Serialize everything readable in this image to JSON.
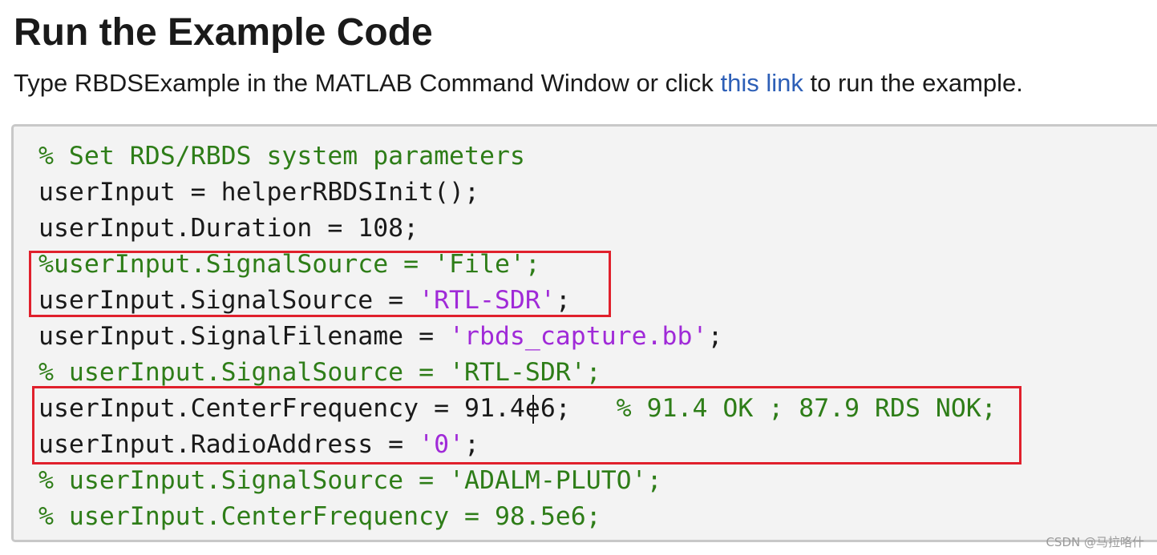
{
  "page": {
    "title": "Run the Example Code",
    "intro": {
      "before": "Type RBDSExample in the MATLAB Command Window or click ",
      "link_text": "this link",
      "after": " to run the example."
    }
  },
  "code_lines": [
    [
      {
        "text": "% Set RDS/RBDS system parameters",
        "type": "comment"
      }
    ],
    [
      {
        "text": "userInput = helperRBDSInit();",
        "type": "plain"
      }
    ],
    [
      {
        "text": "userInput.Duration = 108;",
        "type": "plain"
      }
    ],
    [
      {
        "text": "%userInput.SignalSource = 'File';",
        "type": "comment"
      }
    ],
    [
      {
        "text": "userInput.SignalSource = ",
        "type": "plain"
      },
      {
        "text": "'RTL-SDR'",
        "type": "string"
      },
      {
        "text": ";",
        "type": "plain"
      }
    ],
    [
      {
        "text": "userInput.SignalFilename = ",
        "type": "plain"
      },
      {
        "text": "'rbds_capture.bb'",
        "type": "string"
      },
      {
        "text": ";",
        "type": "plain"
      }
    ],
    [
      {
        "text": "% userInput.SignalSource = 'RTL-SDR';",
        "type": "comment"
      }
    ],
    [
      {
        "text": "userInput.CenterFrequency = 91.4e6;   ",
        "type": "plain"
      },
      {
        "text": "% 91.4 OK ; 87.9 RDS NOK;",
        "type": "comment"
      }
    ],
    [
      {
        "text": "userInput.RadioAddress = ",
        "type": "plain"
      },
      {
        "text": "'0'",
        "type": "string"
      },
      {
        "text": ";",
        "type": "plain"
      }
    ],
    [
      {
        "text": "% userInput.SignalSource = 'ADALM-PLUTO';",
        "type": "comment"
      }
    ],
    [
      {
        "text": "% userInput.CenterFrequency = 98.5e6;",
        "type": "comment"
      }
    ]
  ],
  "colors": {
    "comment": "#2e7d18",
    "string": "#a02ad8",
    "link": "#2d5fb7",
    "highlight_border": "#e0202c"
  },
  "watermark": "CSDN @马拉咯什"
}
